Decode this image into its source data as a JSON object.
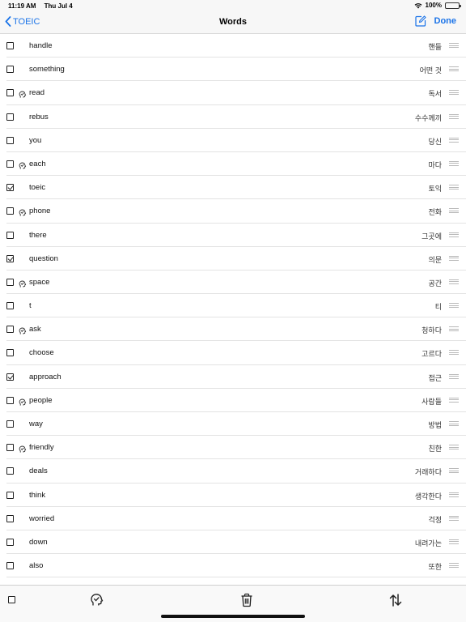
{
  "status": {
    "time": "11:19 AM",
    "date": "Thu Jul 4",
    "battery": "100%",
    "battery_level": 1.0
  },
  "nav": {
    "back_label": "TOEIC",
    "title": "Words",
    "done_label": "Done"
  },
  "words": [
    {
      "word": "handle",
      "meaning": "핸들",
      "checked": false,
      "reviewed": false
    },
    {
      "word": "something",
      "meaning": "어떤 것",
      "checked": false,
      "reviewed": false
    },
    {
      "word": "read",
      "meaning": "독서",
      "checked": false,
      "reviewed": true
    },
    {
      "word": "rebus",
      "meaning": "수수께끼",
      "checked": false,
      "reviewed": false
    },
    {
      "word": "you",
      "meaning": "당신",
      "checked": false,
      "reviewed": false
    },
    {
      "word": "each",
      "meaning": "마다",
      "checked": false,
      "reviewed": true
    },
    {
      "word": "toeic",
      "meaning": "토익",
      "checked": true,
      "reviewed": false
    },
    {
      "word": "phone",
      "meaning": "전화",
      "checked": false,
      "reviewed": true
    },
    {
      "word": "there",
      "meaning": "그곳에",
      "checked": false,
      "reviewed": false
    },
    {
      "word": "question",
      "meaning": "의문",
      "checked": true,
      "reviewed": false
    },
    {
      "word": "space",
      "meaning": "공간",
      "checked": false,
      "reviewed": true
    },
    {
      "word": "t",
      "meaning": "티",
      "checked": false,
      "reviewed": false
    },
    {
      "word": "ask",
      "meaning": "청하다",
      "checked": false,
      "reviewed": true
    },
    {
      "word": "choose",
      "meaning": "고르다",
      "checked": false,
      "reviewed": false
    },
    {
      "word": "approach",
      "meaning": "접근",
      "checked": true,
      "reviewed": false
    },
    {
      "word": "people",
      "meaning": "사람들",
      "checked": false,
      "reviewed": true
    },
    {
      "word": "way",
      "meaning": "방법",
      "checked": false,
      "reviewed": false
    },
    {
      "word": "friendly",
      "meaning": "친한",
      "checked": false,
      "reviewed": true
    },
    {
      "word": "deals",
      "meaning": "거래하다",
      "checked": false,
      "reviewed": false
    },
    {
      "word": "think",
      "meaning": "생각한다",
      "checked": false,
      "reviewed": false
    },
    {
      "word": "worried",
      "meaning": "걱정",
      "checked": false,
      "reviewed": false
    },
    {
      "word": "down",
      "meaning": "내려가는",
      "checked": false,
      "reviewed": false
    },
    {
      "word": "also",
      "meaning": "또한",
      "checked": false,
      "reviewed": false
    }
  ],
  "icons": {
    "back": "chevron-left-icon",
    "edit": "compose-icon",
    "reviewed": "head-check-icon",
    "reorder": "drag-handle-icon",
    "trash": "trash-icon",
    "sort": "sort-arrows-icon"
  },
  "colors": {
    "accent": "#1a73e8"
  }
}
